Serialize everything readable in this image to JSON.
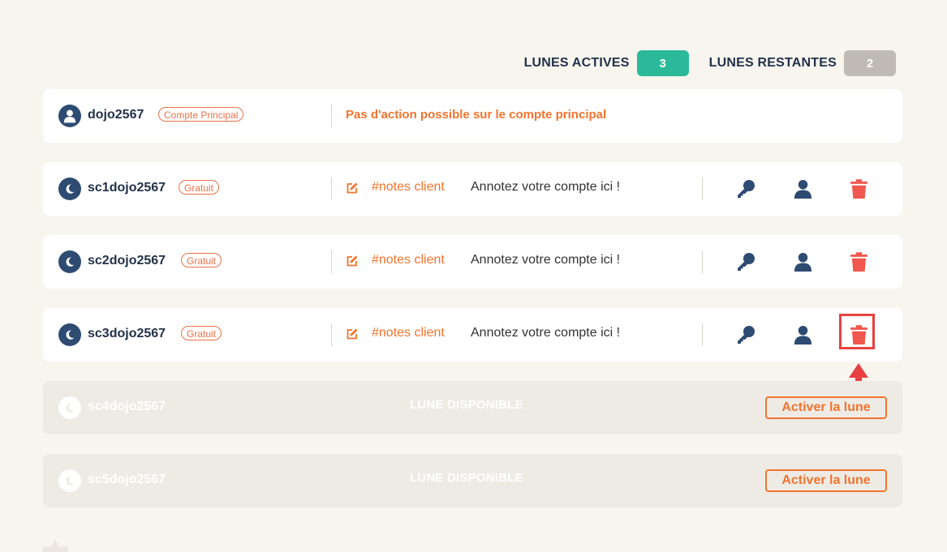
{
  "counters": {
    "active_label": "LUNES ACTIVES",
    "active_value": "3",
    "remaining_label": "LUNES RESTANTES",
    "remaining_value": "2"
  },
  "main_account": {
    "username": "dojo2567",
    "tag": "Compte Principal",
    "notice": "Pas d'action possible sur le compte principal"
  },
  "active_accounts": [
    {
      "username": "sc1dojo2567",
      "tag": "Gratuit",
      "notes_tag": "#notes client",
      "notes_text": "Annotez votre compte ici !"
    },
    {
      "username": "sc2dojo2567",
      "tag": "Gratuit",
      "notes_tag": "#notes client",
      "notes_text": "Annotez votre compte ici !"
    },
    {
      "username": "sc3dojo2567",
      "tag": "Gratuit",
      "notes_tag": "#notes client",
      "notes_text": "Annotez votre compte ici !"
    }
  ],
  "available_accounts": [
    {
      "username": "sc4dojo2567",
      "status": "LUNE DISPONIBLE",
      "button": "Activer la lune"
    },
    {
      "username": "sc5dojo2567",
      "status": "LUNE DISPONIBLE",
      "button": "Activer la lune"
    }
  ],
  "colors": {
    "accent": "#f0742e",
    "teal": "#2bb99a",
    "navy": "#2e4b72",
    "delete": "#f0584f",
    "highlight": "#e74141"
  },
  "icons": [
    "user-icon",
    "moon-icon",
    "edit-icon",
    "key-icon",
    "person-icon",
    "trash-icon",
    "arrow-up-icon"
  ]
}
